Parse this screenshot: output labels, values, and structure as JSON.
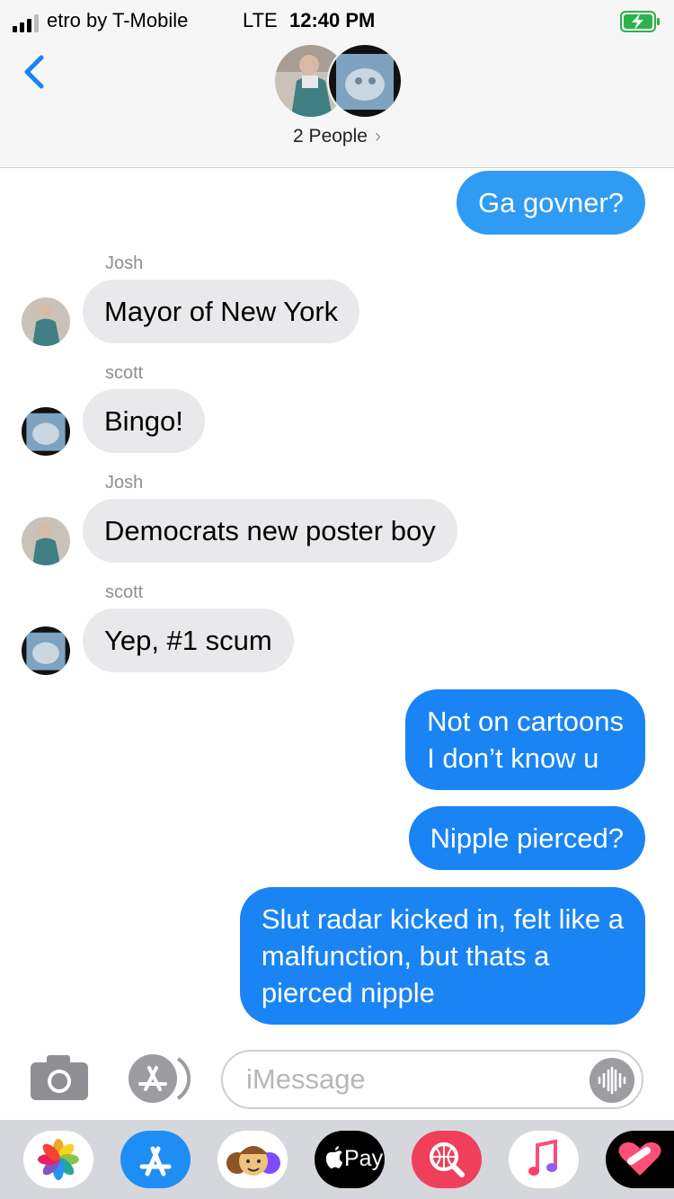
{
  "status_bar": {
    "carrier": "etro by T-Mobile",
    "network": "LTE",
    "time": "12:40 PM"
  },
  "header": {
    "group_label": "2 People",
    "chevron": "›"
  },
  "messages": [
    {
      "text": "Ga govner?"
    },
    {
      "sender": "Josh",
      "text": "Mayor of New York"
    },
    {
      "sender": "scott",
      "text": "Bingo!"
    },
    {
      "sender": "Josh",
      "text": "Democrats new poster boy"
    },
    {
      "sender": "scott",
      "text": "Yep, #1 scum"
    },
    {
      "lines": [
        "Not on cartoons",
        "I don’t know u"
      ]
    },
    {
      "text": "Nipple pierced?"
    },
    {
      "lines": [
        "Slut radar kicked in, felt like a",
        "malfunction, but thats a",
        "pierced nipple"
      ]
    }
  ],
  "composer": {
    "placeholder": "iMessage"
  },
  "app_drawer": [
    {
      "icon": "photos-icon"
    },
    {
      "icon": "app-store-icon"
    },
    {
      "icon": "memoji-icon"
    },
    {
      "icon": "apple-pay-icon",
      "label": "Pay"
    },
    {
      "icon": "web-search-icon"
    },
    {
      "icon": "music-icon"
    },
    {
      "icon": "heart-sticker-icon"
    }
  ],
  "colors": {
    "accent": "#1a84f5",
    "outgoing_light": "#2f9bf3",
    "incoming": "#e9e9eb",
    "header": "#f6f6f6",
    "drawer": "#d5d7dc"
  }
}
